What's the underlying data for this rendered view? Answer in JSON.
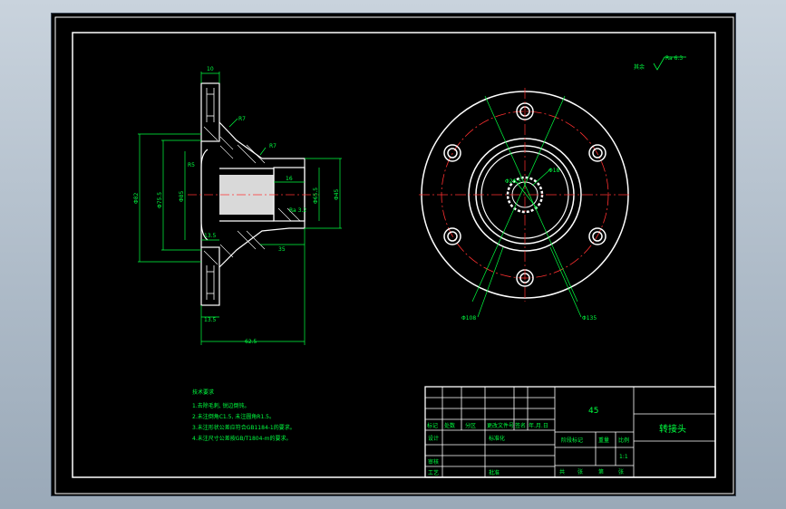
{
  "drawing": {
    "part_title": "转接头",
    "material": "45",
    "scale": "1:1",
    "roughness_note": "其余",
    "roughness_value": "Ra 6.3",
    "tech_requirements_title": "技术要求",
    "tech_requirements": [
      "1.去除毛刺, 锐边倒钝。",
      "2.未注倒角C1.5, 未注圆角R1.5。",
      "3.未注形状公差应符合GB1184-1的要求。",
      "4.未注尺寸公差按GB/T1804-m的要求。"
    ],
    "section_dims": {
      "top_width": "10",
      "r7": "R7",
      "r7b": "R7",
      "r5": "R5",
      "d_left_outer": "Φ82",
      "d_left_mid": "Φ75.5",
      "d_inner": "Φ85",
      "d_shaft": "Φ65.5",
      "d_right": "Φ45",
      "d16": "16",
      "d13_top": "13.5",
      "d35": "35",
      "d13_bottom": "13.5",
      "d_total": "62.5",
      "ra_label": "Ra 3.2"
    },
    "front_dims": {
      "d26": "Φ26.5",
      "d18": "Φ18",
      "d108": "Φ108",
      "d135": "Φ135"
    },
    "title_block": {
      "headers": [
        "标记",
        "处数",
        "分区",
        "更改文件号",
        "签名",
        "年.月.日"
      ],
      "row_labels": [
        "设计",
        "标准化",
        "审核",
        "工艺",
        "批准"
      ],
      "stage_label": "阶段标记",
      "weight_label": "重量",
      "scale_label": "比例",
      "sheet_labels": [
        "共",
        "张",
        "第",
        "张"
      ]
    }
  }
}
